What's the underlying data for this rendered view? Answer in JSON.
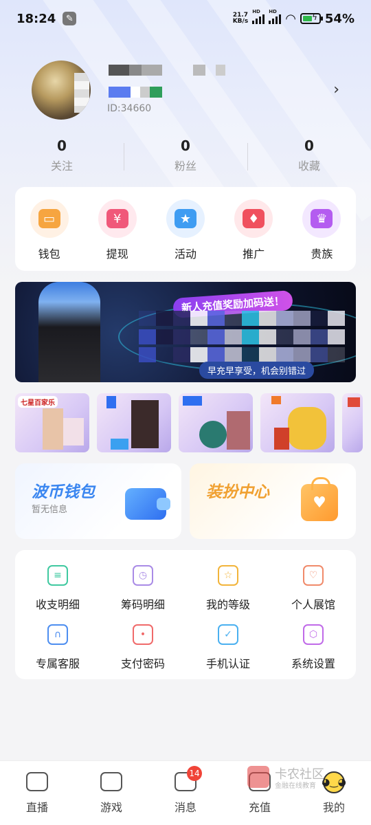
{
  "status_bar": {
    "time": "18:24",
    "net_speed_value": "21.7",
    "net_speed_unit": "KB/s",
    "battery": "54%",
    "battery_level": 0.54,
    "icons": [
      "wrench-icon",
      "signal-icon",
      "wifi-icon",
      "battery-icon"
    ]
  },
  "profile": {
    "user_id": "ID:34660",
    "arrow_icon": "chevron-right-icon"
  },
  "stats": [
    {
      "value": "0",
      "label": "关注"
    },
    {
      "value": "0",
      "label": "粉丝"
    },
    {
      "value": "0",
      "label": "收藏"
    }
  ],
  "quick_actions": [
    {
      "label": "钱包",
      "icon": "wallet-icon",
      "bg": "#fff1e4",
      "color": "#f6a540",
      "glyph": "▭"
    },
    {
      "label": "提现",
      "icon": "withdraw-icon",
      "bg": "#ffe9ee",
      "color": "#f0587a",
      "glyph": "¥"
    },
    {
      "label": "活动",
      "icon": "star-icon",
      "bg": "#e6f1ff",
      "color": "#3e9cf2",
      "glyph": "★"
    },
    {
      "label": "推广",
      "icon": "flame-icon",
      "bg": "#ffe8ea",
      "color": "#f0505e",
      "glyph": "♦"
    },
    {
      "label": "贵族",
      "icon": "crown-icon",
      "bg": "#f3e8ff",
      "color": "#b45cf0",
      "glyph": "♛"
    }
  ],
  "banner": {
    "tag": "新人充值奖励加码送！",
    "slogan": "早充早享受，机会别错过"
  },
  "games": {
    "first_tag": "七星百家乐"
  },
  "wallet_card": {
    "title": "波币钱包",
    "subtitle": "暂无信息"
  },
  "dress_card": {
    "title": "装扮中心",
    "heart": "♥"
  },
  "services": [
    {
      "label": "收支明细",
      "icon": "ledger-icon",
      "color": "#3fc9a0",
      "glyph": "≡"
    },
    {
      "label": "筹码明细",
      "icon": "history-icon",
      "color": "#a98be6",
      "glyph": "◷"
    },
    {
      "label": "我的等级",
      "icon": "level-icon",
      "color": "#f2b43a",
      "glyph": "☆"
    },
    {
      "label": "个人展馆",
      "icon": "gallery-icon",
      "color": "#f08a6a",
      "glyph": "♡"
    },
    {
      "label": "专属客服",
      "icon": "headset-icon",
      "color": "#4d8ef0",
      "glyph": "∩"
    },
    {
      "label": "支付密码",
      "icon": "lock-icon",
      "color": "#f06a6a",
      "glyph": "•"
    },
    {
      "label": "手机认证",
      "icon": "phone-check-icon",
      "color": "#4ab0f0",
      "glyph": "✓"
    },
    {
      "label": "系统设置",
      "icon": "settings-icon",
      "color": "#c06ae8",
      "glyph": "⬡"
    }
  ],
  "bottom_nav": [
    {
      "label": "直播",
      "icon": "tv-icon"
    },
    {
      "label": "游戏",
      "icon": "gamepad-icon"
    },
    {
      "label": "消息",
      "icon": "message-icon"
    },
    {
      "label": "充值",
      "icon": "recharge-icon"
    },
    {
      "label": "我的",
      "icon": "me-icon"
    }
  ],
  "message_badge": "14",
  "watermark": {
    "main": "卡农社区",
    "sub": "金融在线教育"
  }
}
